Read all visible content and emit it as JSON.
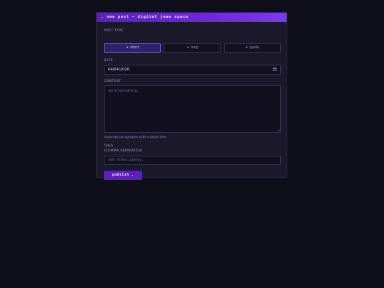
{
  "window": {
    "title": ". new post — digital jean space"
  },
  "form": {
    "post_type_label": "POST TYPE",
    "post_types": [
      {
        "label": "short",
        "icon": "star-icon",
        "selected": true
      },
      {
        "label": "long",
        "icon": "star-icon",
        "selected": false
      },
      {
        "label": "quote",
        "icon": "star-icon",
        "selected": false
      }
    ],
    "star_glyph": "✦",
    "date_label": "DATE",
    "date_value": "04/04/2026",
    "content_label": "CONTENT",
    "content_placeholder": "write something...",
    "content_hint": "separate paragraphs with a blank line.",
    "tags_label_line1": "TAGS",
    "tags_label_line2": "(COMMA SEPARATED)",
    "tags_placeholder": "self, fiction, poetry...",
    "publish_label": "publish ."
  },
  "colors": {
    "background": "#0e0d1a",
    "panel": "#1a1829",
    "accent": "#6d28d9",
    "button": "#5b21b6"
  }
}
